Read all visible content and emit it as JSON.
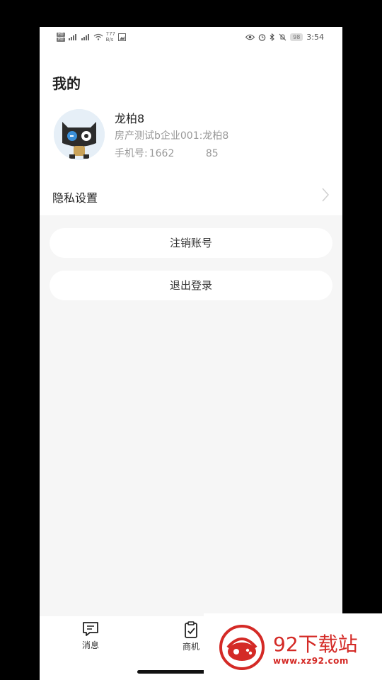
{
  "status_bar": {
    "sim1": "HD",
    "sim2": "HD",
    "net_speed_value": "777",
    "net_speed_unit": "B/s",
    "battery": "98",
    "time": "3:54"
  },
  "header": {
    "title": "我的"
  },
  "profile": {
    "name": "龙柏8",
    "company": "房产测试b企业001:龙柏8",
    "phone_label": "手机号:",
    "phone_value": "1662          85"
  },
  "settings": {
    "privacy_label": "隐私设置"
  },
  "actions": {
    "cancel_account": "注销账号",
    "logout": "退出登录"
  },
  "tab_bar": {
    "tabs": [
      {
        "label": "消息",
        "icon": "message-icon"
      },
      {
        "label": "商机",
        "icon": "clipboard-check-icon"
      }
    ]
  },
  "watermark": {
    "title": "92下载站",
    "url": "www.xz92.com"
  },
  "colors": {
    "accent_red": "#d42a26",
    "grey_bg": "#f6f6f6"
  }
}
